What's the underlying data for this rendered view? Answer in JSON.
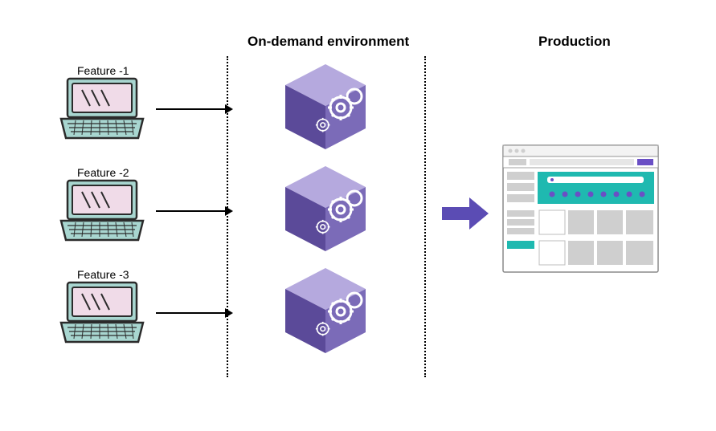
{
  "headings": {
    "environment": "On-demand  environment",
    "production": "Production"
  },
  "features": [
    {
      "label": "Feature -1"
    },
    {
      "label": "Feature -2"
    },
    {
      "label": "Feature -3"
    }
  ],
  "colors": {
    "cube_light": "#a598d6",
    "cube_mid": "#8475c1",
    "cube_dark": "#5b4a99",
    "arrow_purple": "#5b4cb4",
    "laptop_screen": "#f0dbe8",
    "laptop_body": "#a8d6d0",
    "laptop_outline": "#2b2b2b",
    "browser_gray": "#cfcfcf",
    "browser_teal": "#1fb9b0",
    "browser_purple": "#6a4fc5"
  },
  "diagram": {
    "type": "flow",
    "description": "Three feature development laptops each deploy to an isolated on-demand environment (cube). All on-demand environments promote to a single production website.",
    "nodes": {
      "laptops": [
        "Feature -1",
        "Feature -2",
        "Feature -3"
      ],
      "environments": 3,
      "production": 1
    }
  }
}
